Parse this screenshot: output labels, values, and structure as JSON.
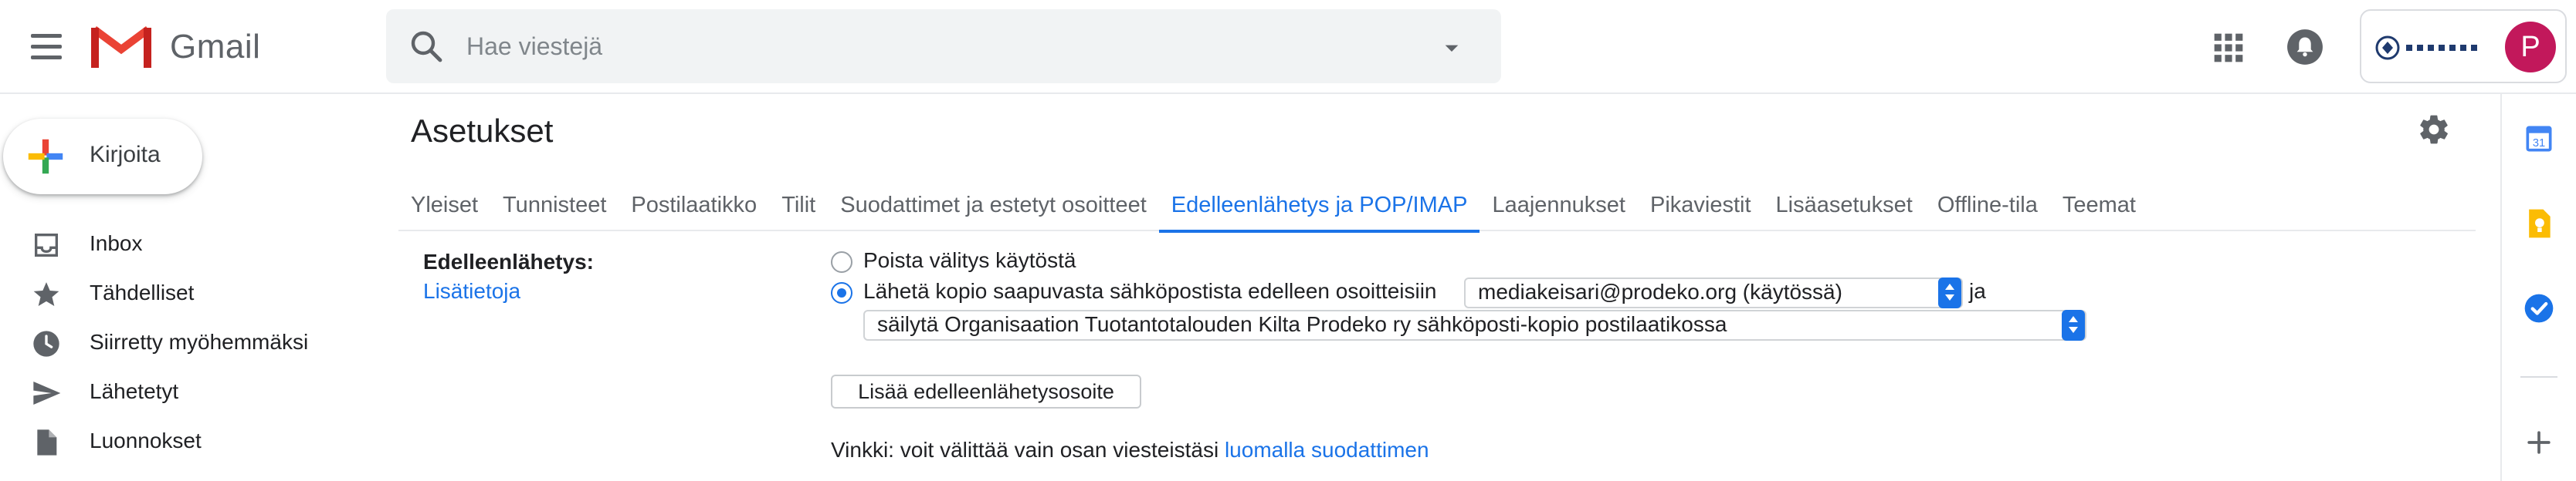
{
  "header": {
    "app_name": "Gmail",
    "search_placeholder": "Hae viestejä",
    "avatar_letter": "P"
  },
  "sidebar": {
    "compose_label": "Kirjoita",
    "items": [
      {
        "label": "Inbox",
        "icon": "inbox-icon"
      },
      {
        "label": "Tähdelliset",
        "icon": "star-icon"
      },
      {
        "label": "Siirretty myöhemmäksi",
        "icon": "clock-icon"
      },
      {
        "label": "Lähetetyt",
        "icon": "send-icon"
      },
      {
        "label": "Luonnokset",
        "icon": "draft-icon"
      }
    ]
  },
  "main": {
    "title": "Asetukset",
    "tabs": [
      {
        "label": "Yleiset"
      },
      {
        "label": "Tunnisteet"
      },
      {
        "label": "Postilaatikko"
      },
      {
        "label": "Tilit"
      },
      {
        "label": "Suodattimet ja estetyt osoitteet"
      },
      {
        "label": "Edelleenlähetys ja POP/IMAP",
        "active": true
      },
      {
        "label": "Laajennukset"
      },
      {
        "label": "Pikaviestit"
      },
      {
        "label": "Lisäasetukset"
      },
      {
        "label": "Offline-tila"
      },
      {
        "label": "Teemat"
      }
    ],
    "forwarding": {
      "label": "Edelleenlähetys:",
      "learn_more": "Lisätietoja",
      "option_disable": "Poista välitys käytöstä",
      "option_forward": "Lähetä kopio saapuvasta sähköpostista edelleen osoitteisiin",
      "forward_address": "mediakeisari@prodeko.org (käytössä)",
      "conjunction": "ja",
      "keep_action": "säilytä Organisaation Tuotantotalouden Kilta Prodeko ry sähköposti-kopio postilaatikossa",
      "add_button": "Lisää edelleenlähetysosoite",
      "tip_prefix": "Vinkki: voit välittää vain osan viesteistäsi",
      "tip_link": "luomalla suodattimen"
    }
  },
  "colors": {
    "accent": "#1a73e8",
    "avatar": "#c2185b",
    "gmail_red": "#ea4335"
  }
}
